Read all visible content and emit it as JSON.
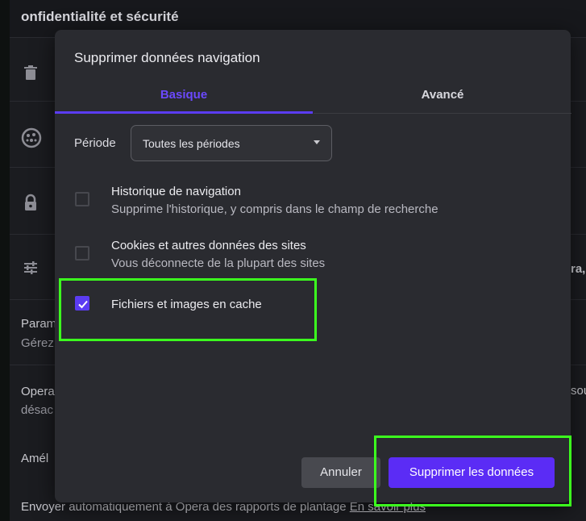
{
  "background": {
    "section_title": "onfidentialité et sécurité",
    "row_texts": {
      "r1_title": "Param",
      "r1_desc": "Gérez",
      "r2_title": "Opera",
      "r2_desc": "désac",
      "r3_title": "Amél",
      "r4_title": "Envoyer automatiquement à Opera des rapports de plantage",
      "r4_link": "En savoir plus",
      "right_frag_1": "ra,",
      "right_frag_2": "sou"
    },
    "icons": [
      "trash-icon",
      "cookie-icon",
      "lock-icon",
      "sliders-icon"
    ]
  },
  "dialog": {
    "title": "Supprimer données navigation",
    "tabs": [
      {
        "label": "Basique",
        "active": true
      },
      {
        "label": "Avancé",
        "active": false
      }
    ],
    "period": {
      "label": "Période",
      "value": "Toutes les périodes"
    },
    "options": [
      {
        "title": "Historique de navigation",
        "desc": "Supprime l'historique, y compris dans le champ de recherche",
        "checked": false
      },
      {
        "title": "Cookies et autres données des sites",
        "desc": "Vous déconnecte de la plupart des sites",
        "checked": false
      },
      {
        "title": "Fichiers et images en cache",
        "desc": "",
        "checked": true
      }
    ],
    "buttons": {
      "cancel": "Annuler",
      "confirm": "Supprimer les données"
    }
  },
  "colors": {
    "accent": "#5b3cf2",
    "highlight": "#3cff1e"
  }
}
